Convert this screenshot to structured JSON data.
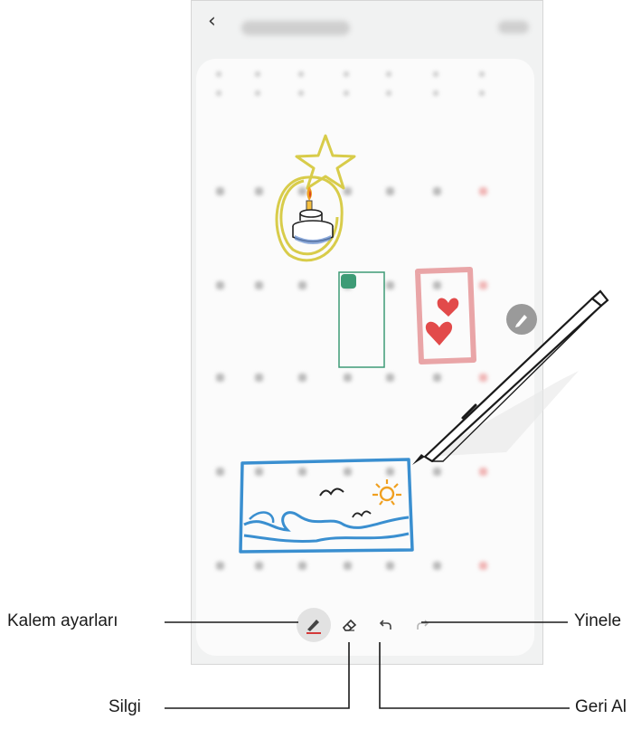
{
  "header": {
    "back_icon": "chevron-left-icon",
    "title_blurred": "",
    "save_blurred": ""
  },
  "pen_toolbar": {
    "buttons": [
      {
        "id": "pen-settings",
        "icon": "pen-icon"
      },
      {
        "id": "eraser",
        "icon": "eraser-icon"
      },
      {
        "id": "undo",
        "icon": "undo-icon"
      },
      {
        "id": "redo",
        "icon": "redo-icon"
      }
    ]
  },
  "callouts": {
    "pen_settings": "Kalem ayarları",
    "eraser": "Silgi",
    "redo": "Yinele",
    "undo": "Geri Al"
  },
  "colors": {
    "accent_green": "#3e9b76",
    "sketch_blue": "#3a8fd0",
    "sketch_yellow": "#d8cc4a",
    "sketch_pink": "#e9a5a7",
    "heart_red": "#e24a4a",
    "sun_orange": "#f0a020"
  }
}
